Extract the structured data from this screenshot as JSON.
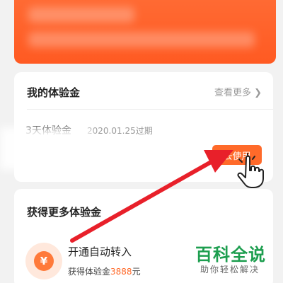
{
  "card1": {
    "title": "我的体验金",
    "see_more": "查看更多 ❯",
    "coupon_name": "3天体验金",
    "coupon_expiry": "2020.01.25过期",
    "use_button": "去使用"
  },
  "card2": {
    "title": "获得更多体验金",
    "item_title": "开通自动转入",
    "item_sub_prefix": "获得体验金",
    "item_amount": "3888",
    "item_unit": "元",
    "yen_symbol": "¥"
  },
  "watermark": {
    "main": "百科全说",
    "sub": "助你轻松解决"
  },
  "colors": {
    "accent": "#ff6a2a",
    "arrow": "#e8202a",
    "watermark": "#1d9e4f"
  },
  "icons": [
    "yen-icon",
    "pointing-hand-icon",
    "chevron-right-icon"
  ]
}
